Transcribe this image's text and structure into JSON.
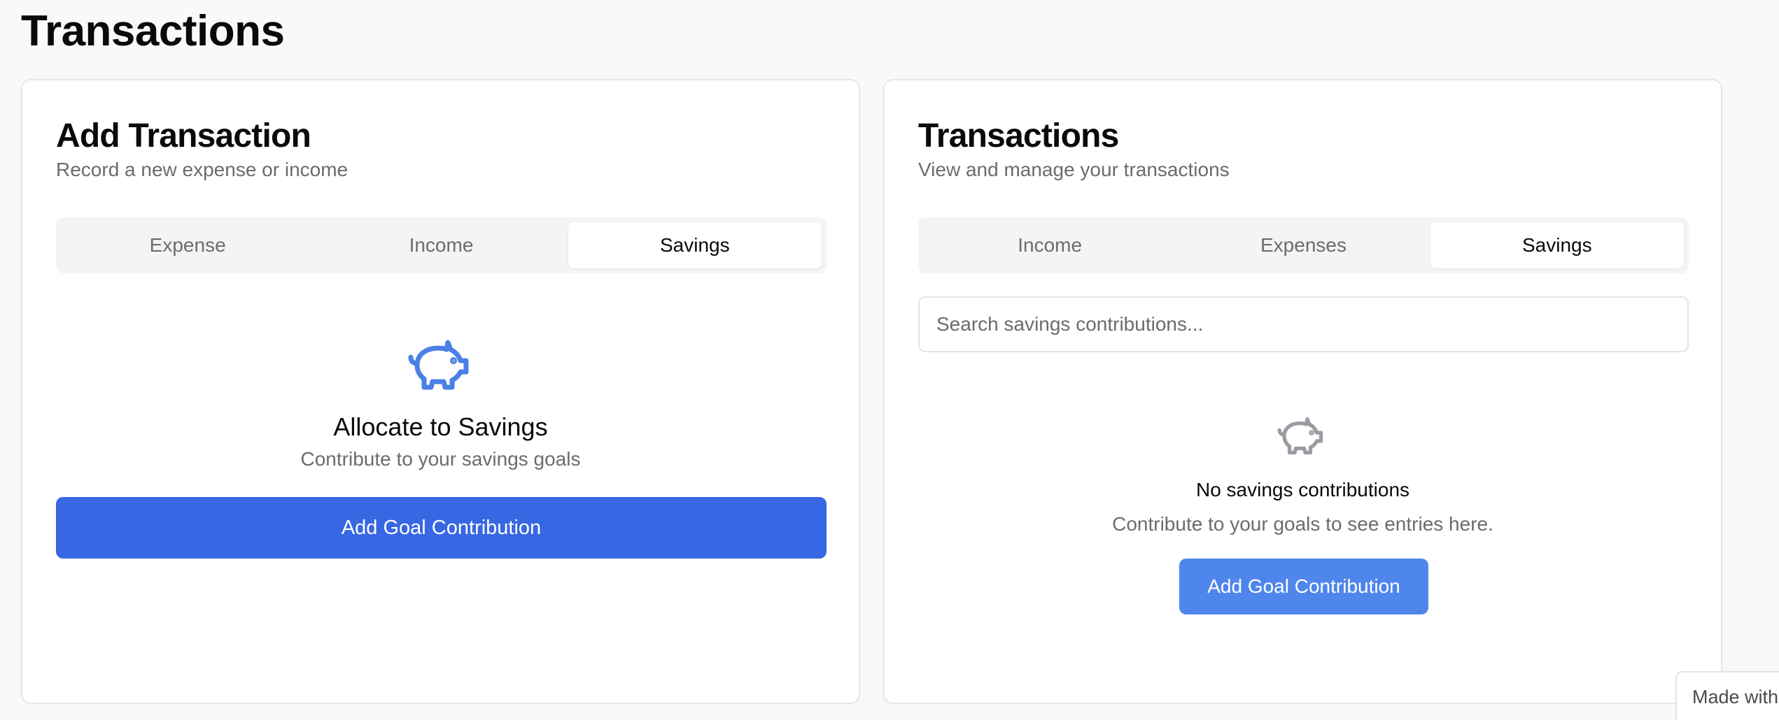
{
  "page": {
    "title": "Transactions"
  },
  "add_card": {
    "title": "Add Transaction",
    "subtitle": "Record a new expense or income",
    "tabs": [
      {
        "label": "Expense",
        "active": false
      },
      {
        "label": "Income",
        "active": false
      },
      {
        "label": "Savings",
        "active": true
      }
    ],
    "icon": "piggy-bank-icon",
    "heading": "Allocate to Savings",
    "description": "Contribute to your savings goals",
    "button_label": "Add Goal Contribution"
  },
  "list_card": {
    "title": "Transactions",
    "subtitle": "View and manage your transactions",
    "tabs": [
      {
        "label": "Income",
        "active": false
      },
      {
        "label": "Expenses",
        "active": false
      },
      {
        "label": "Savings",
        "active": true
      }
    ],
    "search": {
      "placeholder": "Search savings contributions...",
      "value": ""
    },
    "empty_state": {
      "icon": "piggy-bank-icon",
      "title": "No savings contributions",
      "description": "Contribute to your goals to see entries here.",
      "button_label": "Add Goal Contribution"
    }
  },
  "badge": {
    "text": "Made with"
  },
  "colors": {
    "primary": "#3867e3",
    "primary_light": "#4f86ec",
    "icon_blue": "#4a7fe6",
    "icon_gray": "#9a9ca3",
    "muted_text": "#6b6b70",
    "background": "#f8f9fb"
  }
}
